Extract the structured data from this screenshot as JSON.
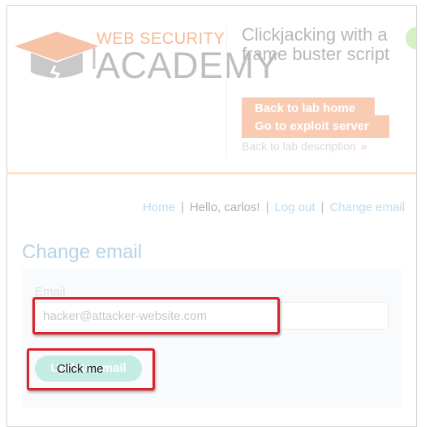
{
  "header": {
    "logo": {
      "line1": "WEB SECURITY",
      "line2": "ACADEMY"
    },
    "lab_title": "Clickjacking with a frame buster script",
    "back_to_lab_home": "Back to lab home",
    "go_to_exploit_server": "Go to exploit server",
    "back_to_lab_description": "Back to lab description",
    "back_chevron": "»"
  },
  "nav": {
    "home": "Home",
    "separator": "|",
    "hello": "Hello, carlos!",
    "log_out": "Log out",
    "change_email": "Change email"
  },
  "main": {
    "title": "Change email",
    "email_label": "Email",
    "email_value": "hacker@attacker-website.com",
    "update_button": "Update email"
  },
  "overlay": {
    "decoy_label": "Click me"
  },
  "colors": {
    "brand_orange": "#f9cbb3",
    "logo_gray": "#bfbfbf",
    "link_blue": "#bcdcef",
    "button_teal": "#c5ece2",
    "decoy_red": "#d9232d"
  }
}
